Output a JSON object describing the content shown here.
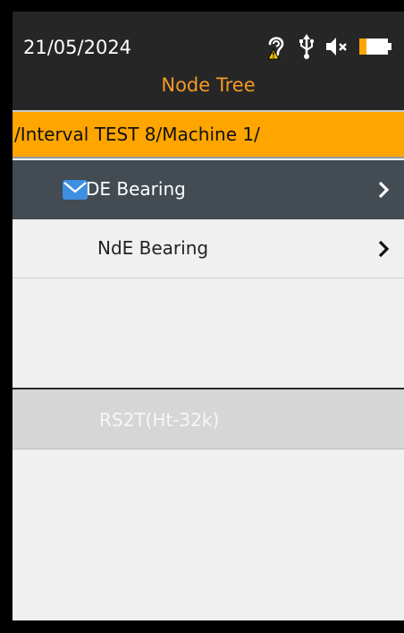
{
  "status_bar": {
    "date": "21/05/2024",
    "icons": [
      "hearing-warning-icon",
      "usb-icon",
      "speaker-muted-icon",
      "battery-icon"
    ],
    "battery_color": "#ffa500"
  },
  "title": "Node Tree",
  "path": "/Interval TEST 8/Machine 1/",
  "nodes": [
    {
      "label": "DE Bearing",
      "icon": "envelope-icon",
      "selected": true
    },
    {
      "label": "NdE Bearing",
      "icon": "",
      "selected": false
    }
  ],
  "sensor": {
    "label": "RS2T(Ht-32k)"
  },
  "colors": {
    "title": "#f39a27",
    "path_bar": "#ffa500",
    "selected_row": "#434b53",
    "envelope": "#3d8fe0"
  }
}
